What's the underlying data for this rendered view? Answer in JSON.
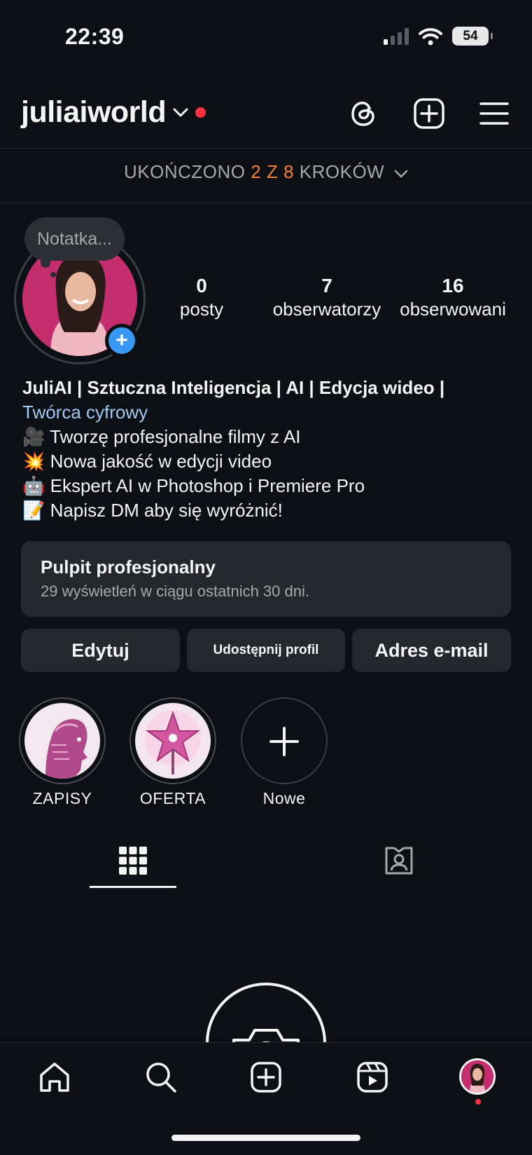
{
  "status_bar": {
    "time": "22:39",
    "battery": "54"
  },
  "header": {
    "username": "juliaiworld"
  },
  "steps": {
    "prefix": "UKOŃCZONO ",
    "done": "2",
    "middle": " Z ",
    "total": "8",
    "suffix": " KROKÓW"
  },
  "note": {
    "placeholder": "Notatka..."
  },
  "stats": [
    {
      "value": "0",
      "label": "posty"
    },
    {
      "value": "7",
      "label": "obserwatorzy"
    },
    {
      "value": "16",
      "label": "obserwowani"
    }
  ],
  "bio": {
    "name": "JuliAI | Sztuczna Inteligencja | AI | Edycja wideo |",
    "category": "Twórca cyfrowy",
    "lines": [
      "🎥 Tworzę profesjonalne filmy z AI",
      "💥 Nowa jakość w edycji video",
      "🤖 Ekspert AI w Photoshop i Premiere Pro",
      "📝 Napisz DM aby się wyróżnić!"
    ]
  },
  "dashboard": {
    "title": "Pulpit profesjonalny",
    "subtitle": "29 wyświetleń w ciągu ostatnich 30 dni."
  },
  "buttons": {
    "edit": "Edytuj",
    "share": "Udostępnij profil",
    "email": "Adres e-mail"
  },
  "highlights": [
    {
      "label": "ZAPISY"
    },
    {
      "label": "OFERTA"
    },
    {
      "label": "Nowe"
    }
  ],
  "colors": {
    "background": "#0c1014",
    "accent_orange": "#f0803c",
    "link_blue": "#9fc9f5",
    "badge_blue": "#3897f0",
    "notification_red": "#ff3040"
  }
}
